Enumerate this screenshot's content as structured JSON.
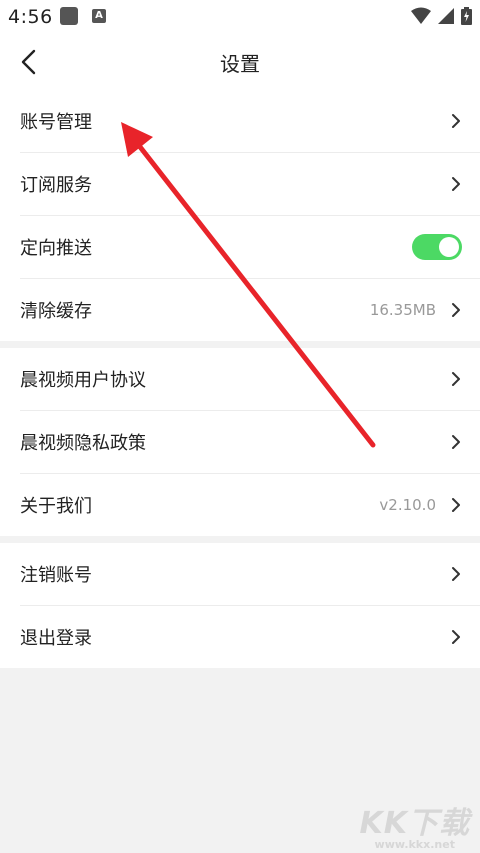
{
  "status_bar": {
    "time": "4:56",
    "app_icon_2_letter": "A"
  },
  "header": {
    "title": "设置",
    "back_icon": "chevron-left-icon"
  },
  "groups": [
    {
      "items": [
        {
          "label": "账号管理"
        },
        {
          "label": "订阅服务"
        },
        {
          "label": "定向推送",
          "toggle_on": true
        },
        {
          "label": "清除缓存",
          "value": "16.35MB"
        }
      ]
    },
    {
      "items": [
        {
          "label": "晨视频用户协议"
        },
        {
          "label": "晨视频隐私政策"
        },
        {
          "label": "关于我们",
          "value": "v2.10.0"
        }
      ]
    },
    {
      "items": [
        {
          "label": "注销账号"
        },
        {
          "label": "退出登录"
        }
      ]
    }
  ],
  "colors": {
    "toggle_on": "#4cd964",
    "arrow": "#e8242a",
    "background": "#f2f2f2"
  },
  "watermark": {
    "logo": "KK下载",
    "url": "www.kkx.net"
  }
}
